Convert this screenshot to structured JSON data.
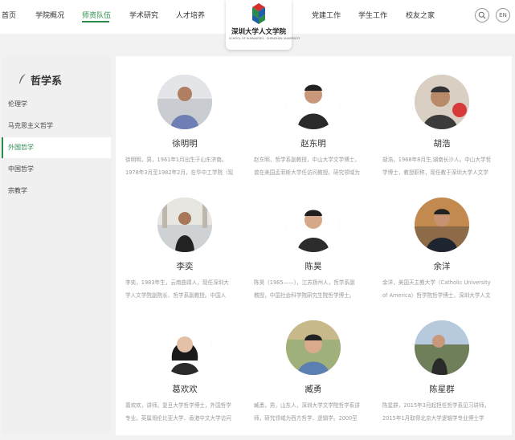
{
  "nav": {
    "items": [
      "首页",
      "学院概况",
      "师资队伍",
      "学术研究",
      "人才培养",
      "党建工作",
      "学生工作",
      "校友之家"
    ],
    "active": "师资队伍",
    "lang_label": "EN"
  },
  "logo": {
    "title": "深圳大学人文学院",
    "subtitle": "SCHOOL OF HUMANITIES · SHENZHEN UNIVERSITY"
  },
  "sidebar": {
    "title": "哲学系",
    "items": [
      {
        "label": "伦理学",
        "active": false
      },
      {
        "label": "马克思主义哲学",
        "active": false
      },
      {
        "label": "外国哲学",
        "active": true
      },
      {
        "label": "中国哲学",
        "active": false
      },
      {
        "label": "宗教学",
        "active": false
      }
    ]
  },
  "people": [
    {
      "name": "徐明明",
      "desc1": "徐明明，男，1961年1月出生于山东济南。",
      "desc2": "1978年3月至1982年2月，在华中工学院（现"
    },
    {
      "name": "赵东明",
      "desc1": "赵东明，哲学系副教授，中山大学文学博士，",
      "desc2": "曾在美国孟菲斯大学任访问教授。研究领域为"
    },
    {
      "name": "胡浩",
      "desc1": "胡浩，1968年8月生,湖南长沙人。中山大学哲",
      "desc2": "学博士，教授职称，现任教于深圳大学人文学"
    },
    {
      "name": "李奕",
      "desc1": "李奕，1983年生，云南曲靖人，现任深圳大",
      "desc2": "学人文学院副院长、哲学系副教授。中国人"
    },
    {
      "name": "陈昊",
      "desc1": "陈昊（1985——），江苏扬州人，哲学系副",
      "desc2": "教授，中国社会科学院研究生院哲学博士。"
    },
    {
      "name": "余洋",
      "desc1": "余洋，美国天主教大学（Catholic University",
      "desc2": "of America）哲学院哲学博士，深圳大学人文"
    },
    {
      "name": "葛欢欢",
      "desc1": "葛欢欢，讲师。复旦大学哲学博士，外国哲学",
      "desc2": "专业。英属哥伦比亚大学、香港中文大学访问"
    },
    {
      "name": "臧勇",
      "desc1": "臧勇，男，山东人，深圳大学文学院哲学系讲",
      "desc2": "师，研究领域为西方哲学、逻辑学。2000至"
    },
    {
      "name": "陈星群",
      "desc1": "陈星群，2015年3月起担任哲学系见习讲师，",
      "desc2": "2015年1月取得北京大学逻辑学专业博士学"
    }
  ],
  "colors": {
    "accent": "#2a8a4a",
    "background": "#f2f2f2",
    "desc_text": "#999999"
  }
}
